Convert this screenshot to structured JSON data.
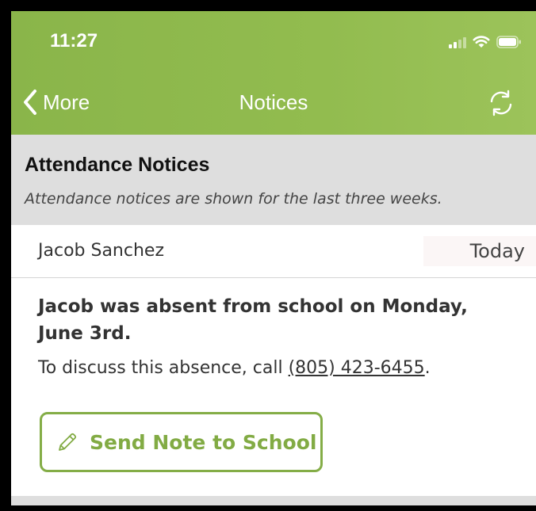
{
  "status_bar": {
    "time": "11:27",
    "icons": [
      "cellular-signal-icon",
      "wifi-icon",
      "battery-icon"
    ]
  },
  "nav": {
    "back_label": "More",
    "title": "Notices",
    "icons": [
      "chevron-left-icon",
      "refresh-icon"
    ]
  },
  "section": {
    "title": "Attendance Notices",
    "subtitle": "Attendance notices are shown for the last three weeks."
  },
  "notice": {
    "student_name": "Jacob Sanchez",
    "date": "Today",
    "headline": "Jacob was absent from school on Monday, June 3rd.",
    "text_before": "To discuss this absence, call ",
    "phone": "(805) 423-6455",
    "text_after": "."
  },
  "action": {
    "send_note_label": "Send Note to School",
    "icon": "pencil-icon"
  },
  "colors": {
    "header_green": "#8ab54a",
    "accent_green": "#82ab44",
    "section_gray": "#dedede"
  }
}
